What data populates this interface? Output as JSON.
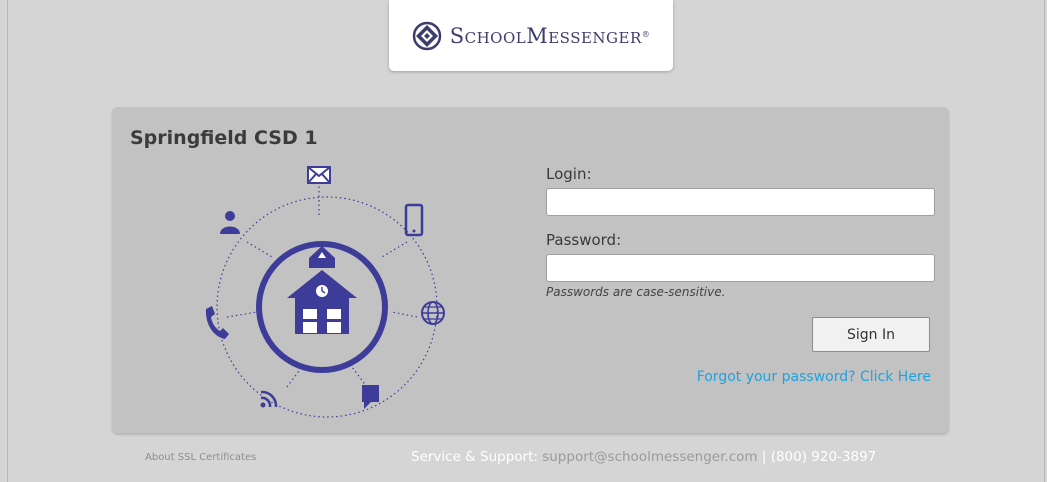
{
  "brand": {
    "logo_icon": "schoolmessenger-logo-icon",
    "name_cap1": "S",
    "name_part1": "CHOOL",
    "name_cap2": "M",
    "name_part2": "ESSENGER",
    "registered": "®",
    "color": "#3c3c6e"
  },
  "panel": {
    "district_name": "Springfield CSD 1"
  },
  "illustration": {
    "center_icon": "schoolhouse-icon",
    "orbit_icons": [
      "envelope-icon",
      "mobile-phone-icon",
      "globe-icon",
      "chat-bubble-icon",
      "rss-icon",
      "phone-icon",
      "person-icon"
    ],
    "color": "#3d3d99"
  },
  "form": {
    "login_label": "Login:",
    "login_value": "",
    "password_label": "Password:",
    "password_value": "",
    "password_hint": "Passwords are case-sensitive.",
    "signin_label": "Sign In",
    "forgot_link": "Forgot your password? Click Here",
    "link_color": "#1fa3e0"
  },
  "footer": {
    "ssl_link": "About SSL Certificates",
    "support_label": "Service & Support:",
    "support_email": "support@schoolmessenger.com",
    "separator": "|",
    "support_phone": "(800) 920-3897"
  }
}
